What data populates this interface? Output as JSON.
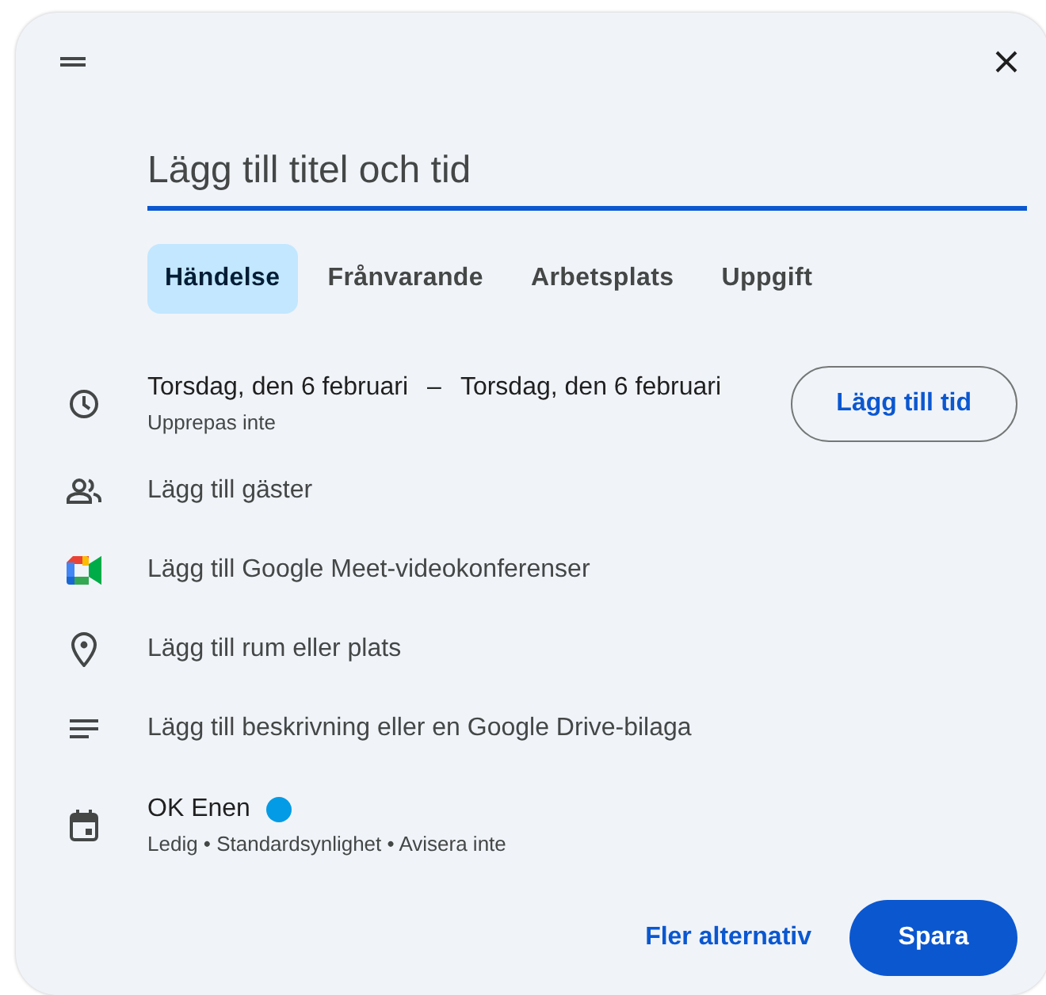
{
  "title_field": {
    "placeholder": "Lägg till titel och tid"
  },
  "tabs": [
    {
      "label": "Händelse",
      "selected": true
    },
    {
      "label": "Frånvarande",
      "selected": false
    },
    {
      "label": "Arbetsplats",
      "selected": false
    },
    {
      "label": "Uppgift",
      "selected": false
    }
  ],
  "rows": [
    {
      "kind": "time",
      "text": "Torsdag, den 6 februari",
      "text_end": "Torsdag, den 6 februari",
      "separator": "–",
      "subtext": "Upprepas inte",
      "button": "Lägg till tid"
    },
    {
      "kind": "guests",
      "text": "Lägg till gäster"
    },
    {
      "kind": "meet",
      "text": "Lägg till Google Meet-videokonferenser"
    },
    {
      "kind": "location",
      "text": "Lägg till rum eller plats"
    },
    {
      "kind": "description",
      "text": "Lägg till beskrivning eller en Google Drive-bilaga"
    },
    {
      "kind": "calendar",
      "text": "OK Enen",
      "color": "#039be5",
      "subtext": "Ledig • Standardsynlighet • Avisera inte"
    }
  ],
  "actions": {
    "secondary": "Fler alternativ",
    "primary": "Spara"
  }
}
